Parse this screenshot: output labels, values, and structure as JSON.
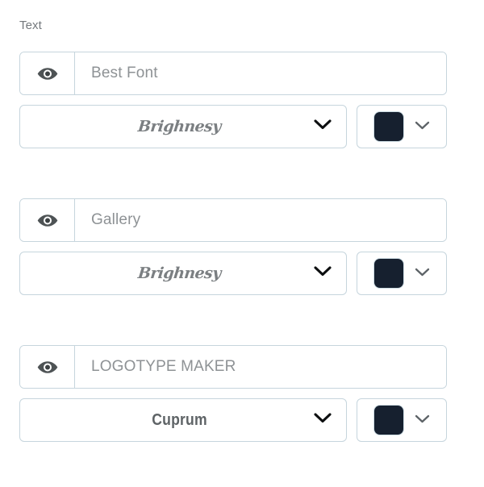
{
  "panel": {
    "section_label": "Text",
    "background_color": "#ffffff",
    "border_color": "#c6d5dd"
  },
  "icons": {
    "visibility": "eye-icon",
    "dropdown": "chevron-down-icon"
  },
  "text_layers": [
    {
      "id": "layer-1",
      "visibility_icon": "eye-icon",
      "text_value": "Best Font",
      "text_placeholder": "Best Font",
      "font": {
        "name": "Brighnesy",
        "style": "script",
        "dropdown_icon": "chevron-down-icon"
      },
      "color": {
        "value": "#16202f",
        "dropdown_icon": "chevron-down-icon"
      }
    },
    {
      "id": "layer-2",
      "visibility_icon": "eye-icon",
      "text_value": "Gallery",
      "text_placeholder": "Gallery",
      "font": {
        "name": "Brighnesy",
        "style": "script",
        "dropdown_icon": "chevron-down-icon"
      },
      "color": {
        "value": "#16202f",
        "dropdown_icon": "chevron-down-icon"
      }
    },
    {
      "id": "layer-3",
      "visibility_icon": "eye-icon",
      "text_value": "LOGOTYPE MAKER",
      "text_placeholder": "LOGOTYPE MAKER",
      "font": {
        "name": "Cuprum",
        "style": "condensed",
        "dropdown_icon": "chevron-down-icon"
      },
      "color": {
        "value": "#16202f",
        "dropdown_icon": "chevron-down-icon"
      }
    }
  ]
}
